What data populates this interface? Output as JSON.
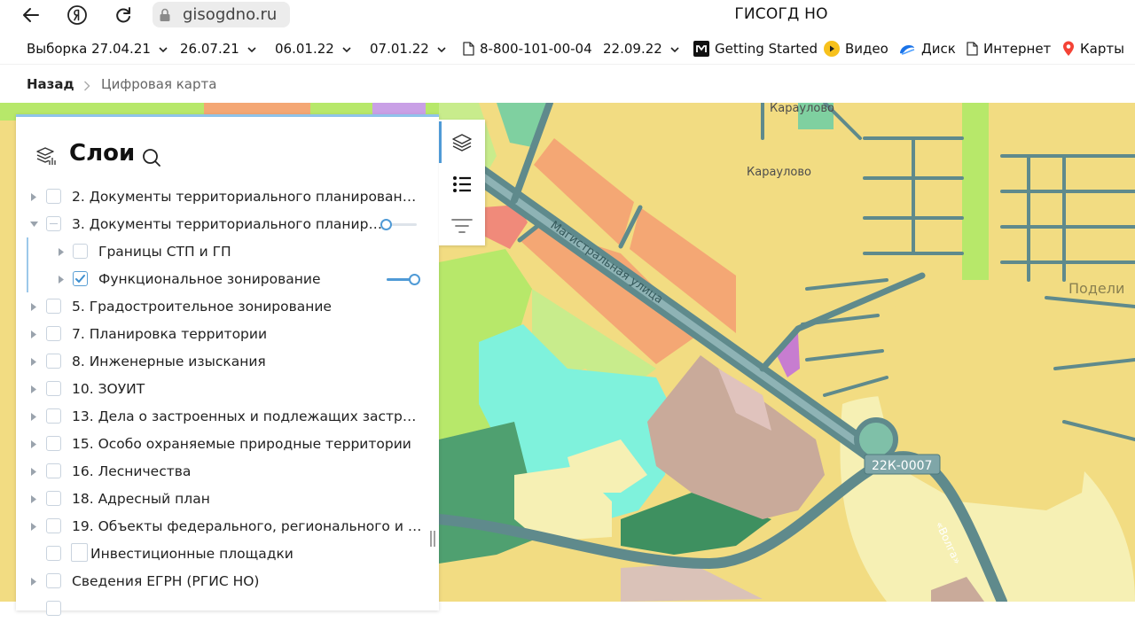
{
  "browser": {
    "url": "gisogdno.ru",
    "title": "ГИСОГД НО"
  },
  "bookmarks": [
    {
      "label": "Выборка 27.04.21",
      "dropdown": true
    },
    {
      "label": "26.07.21",
      "dropdown": true
    },
    {
      "label": "06.01.22",
      "dropdown": true
    },
    {
      "label": "07.01.22",
      "dropdown": true
    },
    {
      "label": "8-800-101-00-04",
      "dropdown": false,
      "icon": "document-icon"
    },
    {
      "label": "22.09.22",
      "dropdown": true
    },
    {
      "label": "Getting Started",
      "dropdown": false,
      "icon": "m-logo-icon"
    },
    {
      "label": "Видео",
      "dropdown": false,
      "icon": "play-icon"
    },
    {
      "label": "Диск",
      "dropdown": false,
      "icon": "cloud-icon"
    },
    {
      "label": "Интернет",
      "dropdown": false,
      "icon": "document-icon"
    },
    {
      "label": "Карты",
      "dropdown": false,
      "icon": "map-pin-icon"
    }
  ],
  "breadcrumb": {
    "back": "Назад",
    "current": "Цифровая карта"
  },
  "layers_panel": {
    "title": "Слои",
    "items": [
      {
        "label": "2. Документы территориального планирования ...",
        "level": 0,
        "expandable": true,
        "expanded": false,
        "checked": "none"
      },
      {
        "label": "3. Документы территориального планиров...",
        "level": 0,
        "expandable": true,
        "expanded": true,
        "checked": "partial",
        "opacity": 0
      },
      {
        "label": "Границы СТП и ГП",
        "level": 1,
        "expandable": true,
        "expanded": false,
        "checked": "none"
      },
      {
        "label": "Функциональное зонирование",
        "level": 1,
        "expandable": true,
        "expanded": false,
        "checked": "checked",
        "opacity": 1
      },
      {
        "label": "5. Градостроительное зонирование",
        "level": 0,
        "expandable": true,
        "expanded": false,
        "checked": "none"
      },
      {
        "label": "7. Планировка территории",
        "level": 0,
        "expandable": true,
        "expanded": false,
        "checked": "none"
      },
      {
        "label": "8. Инженерные изыскания",
        "level": 0,
        "expandable": true,
        "expanded": false,
        "checked": "none"
      },
      {
        "label": "10. ЗОУИТ",
        "level": 0,
        "expandable": true,
        "expanded": false,
        "checked": "none"
      },
      {
        "label": "13. Дела о застроенных и подлежащих застройк...",
        "level": 0,
        "expandable": true,
        "expanded": false,
        "checked": "none"
      },
      {
        "label": "15. Особо охраняемые природные территории",
        "level": 0,
        "expandable": true,
        "expanded": false,
        "checked": "none"
      },
      {
        "label": "16. Лесничества",
        "level": 0,
        "expandable": true,
        "expanded": false,
        "checked": "none"
      },
      {
        "label": "18. Адресный план",
        "level": 0,
        "expandable": true,
        "expanded": false,
        "checked": "none"
      },
      {
        "label": "19. Объекты федерального, регионального и ме...",
        "level": 0,
        "expandable": true,
        "expanded": false,
        "checked": "none"
      },
      {
        "label": "Инвестиционные площадки",
        "level": 0,
        "expandable": false,
        "expanded": false,
        "checked": "none"
      },
      {
        "label": "Сведения ЕГРН (РГИС НО)",
        "level": 0,
        "expandable": true,
        "expanded": false,
        "checked": "none"
      }
    ]
  },
  "map_labels": {
    "street": "Магистральная улица",
    "village1": "Караулово",
    "village2": "Караулово",
    "village3": "Подели",
    "road_code": "22К-0007",
    "river": "«Волга»"
  },
  "colors": {
    "accent": "#4f9ad6",
    "panel_border": "#8fc3ea",
    "zone_yellow": "#f2dc82",
    "zone_orange": "#f4a774",
    "zone_green": "#b7e86a",
    "zone_cyan": "#7ff2dc",
    "zone_brown": "#c9aa9a",
    "road": "#5f8a8c"
  }
}
